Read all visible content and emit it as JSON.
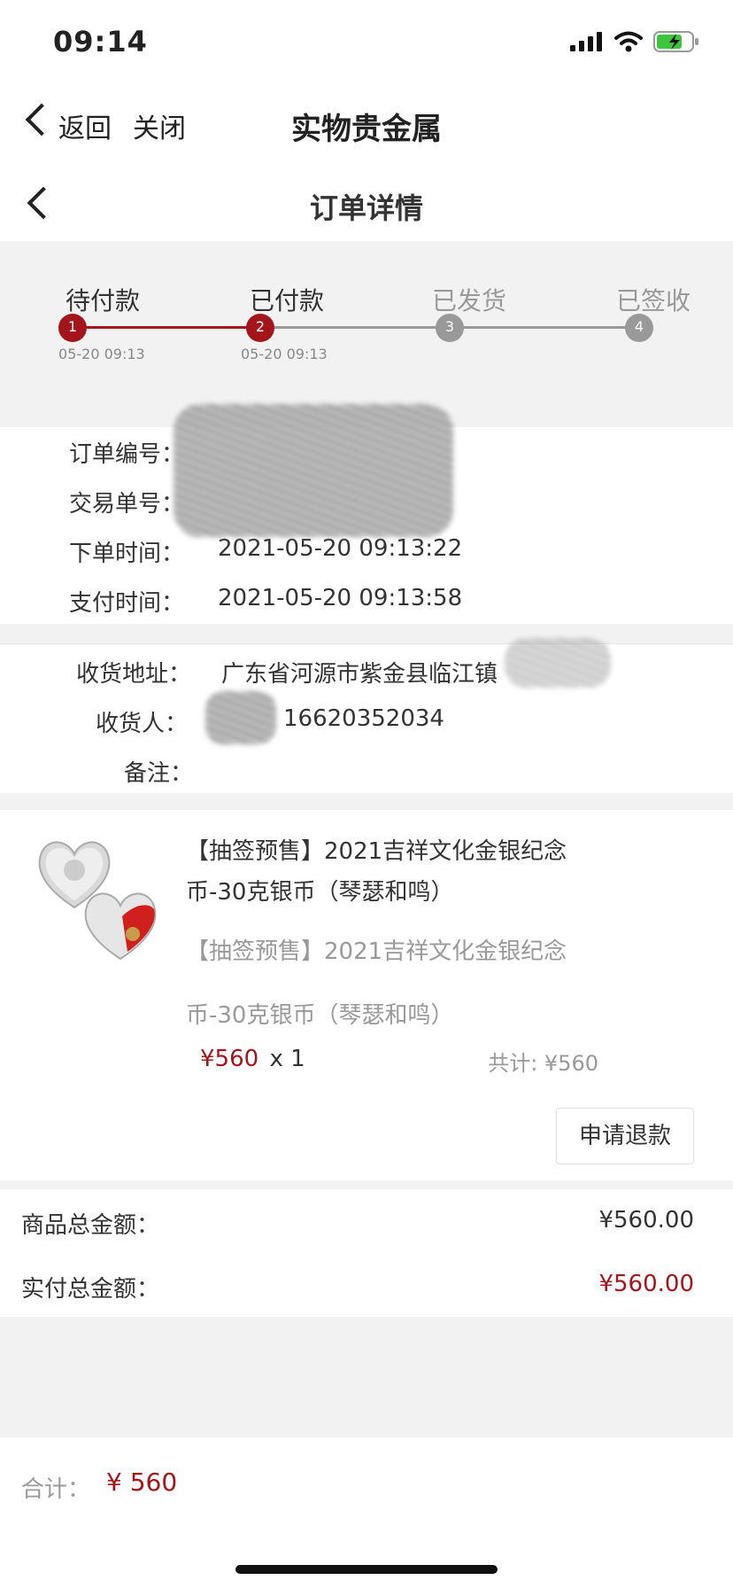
{
  "status_bar": {
    "time": "09:14"
  },
  "header": {
    "back_label": "返回",
    "close_label": "关闭",
    "title": "实物贵金属"
  },
  "page": {
    "title": "订单详情"
  },
  "colors": {
    "accent": "#a4141b",
    "inactive": "#999999",
    "bg": "#f2f2f2"
  },
  "steps": [
    {
      "label": "待付款",
      "num": "1",
      "time": "05-20 09:13",
      "active": true
    },
    {
      "label": "已付款",
      "num": "2",
      "time": "05-20 09:13",
      "active": true
    },
    {
      "label": "已发货",
      "num": "3",
      "time": "",
      "active": false
    },
    {
      "label": "已签收",
      "num": "4",
      "time": "",
      "active": false
    }
  ],
  "order_info": {
    "order_no_label": "订单编号：",
    "trade_no_label": "交易单号：",
    "order_time_label": "下单时间：",
    "order_time": "2021-05-20 09:13:22",
    "pay_time_label": "支付时间：",
    "pay_time": "2021-05-20 09:13:58"
  },
  "shipping": {
    "address_label": "收货地址：",
    "address": "广东省河源市紫金县临江镇",
    "receiver_label": "收货人：",
    "receiver_phone": "16620352034",
    "remark_label": "备注："
  },
  "product": {
    "title": "【抽签预售】2021吉祥文化金银纪念币-30克银币（琴瑟和鸣）",
    "subtitle_line1": "【抽签预售】2021吉祥文化金银纪念",
    "subtitle_line2": "币-30克银币（琴瑟和鸣）",
    "price": "¥560",
    "qty": "x 1",
    "total": "共计: ¥560",
    "refund_label": "申请退款"
  },
  "summary": {
    "goods_total_label": "商品总金额：",
    "goods_total": "¥560.00",
    "paid_total_label": "实付总金额：",
    "paid_total": "¥560.00"
  },
  "footer": {
    "label": "合计：",
    "total": "¥ 560"
  }
}
